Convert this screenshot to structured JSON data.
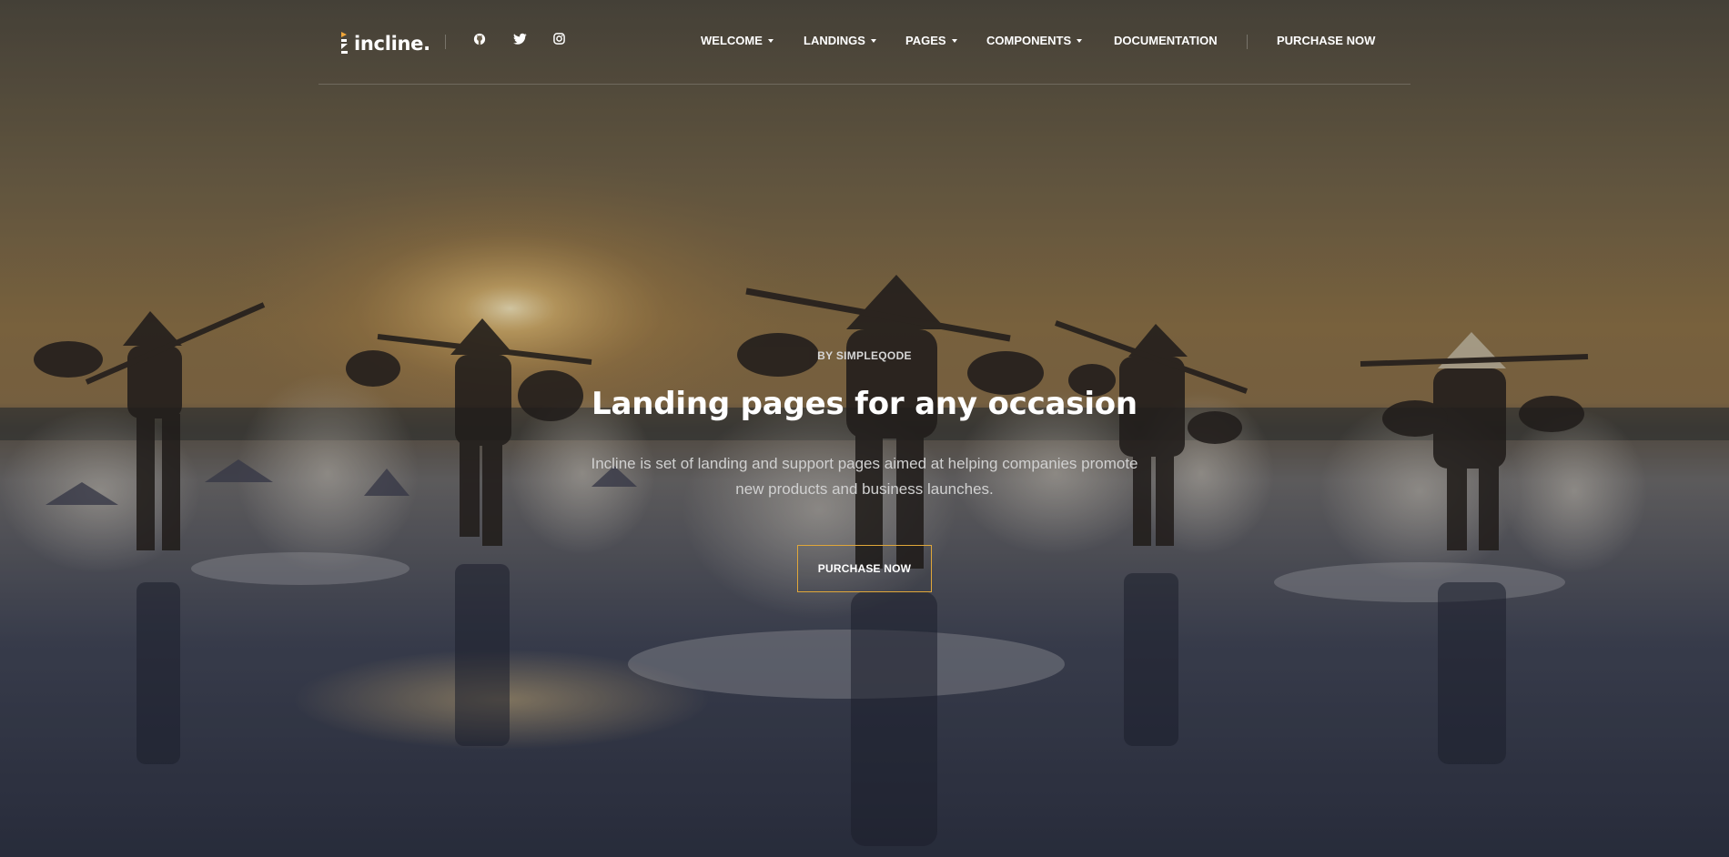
{
  "brand": {
    "name": "incline.",
    "accent_color": "#f0a63a"
  },
  "social": [
    {
      "icon": "github-icon"
    },
    {
      "icon": "twitter-icon"
    },
    {
      "icon": "instagram-icon"
    }
  ],
  "nav": {
    "items": [
      {
        "label": "WELCOME",
        "dropdown": true
      },
      {
        "label": "LANDINGS",
        "dropdown": true
      },
      {
        "label": "PAGES",
        "dropdown": true
      },
      {
        "label": "COMPONENTS",
        "dropdown": true
      },
      {
        "label": "DOCUMENTATION",
        "dropdown": false
      }
    ],
    "purchase_label": "PURCHASE NOW"
  },
  "hero": {
    "eyebrow": "BY SIMPLEQODE",
    "title": "Landing pages for any occasion",
    "description_line1": "Incline is set of landing and support pages aimed at helping companies promote",
    "description_line2": "new products and business launches.",
    "cta_label": "PURCHASE NOW",
    "cta_border_color": "#e0a73a"
  }
}
